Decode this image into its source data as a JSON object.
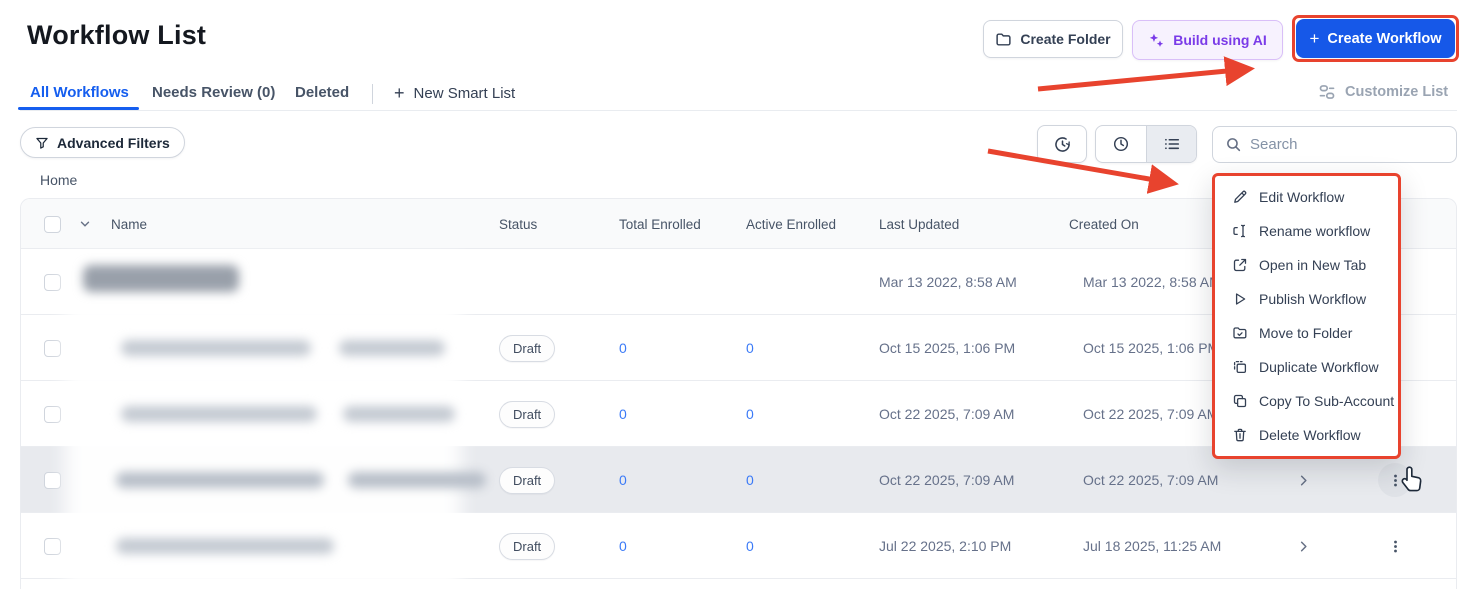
{
  "title": "Workflow List",
  "actions": {
    "plus": "+",
    "create_folder": "Create Folder",
    "build_using_ai": "Build using AI",
    "create_workflow": "Create Workflow"
  },
  "tabs": {
    "all_workflows": "All Workflows",
    "needs_review": "Needs Review (0)",
    "deleted": "Deleted",
    "new_smart_list": "New Smart List"
  },
  "customize_list": "Customize List",
  "advanced_filters": "Advanced Filters",
  "search": {
    "placeholder": "Search"
  },
  "breadcrumb": "Home",
  "table": {
    "headers": {
      "name": "Name",
      "status": "Status",
      "total_enrolled": "Total Enrolled",
      "active_enrolled": "Active Enrolled",
      "last_updated": "Last Updated",
      "created_on": "Created On"
    },
    "rows": [
      {
        "status": "",
        "total_enrolled": "",
        "active_enrolled": "",
        "last_updated": "Mar 13 2022, 8:58 AM",
        "created_on": "Mar 13 2022, 8:58 AM",
        "highlighted": false
      },
      {
        "status": "Draft",
        "total_enrolled": "0",
        "active_enrolled": "0",
        "last_updated": "Oct 15 2025, 1:06 PM",
        "created_on": "Oct 15 2025, 1:06 PM",
        "highlighted": false
      },
      {
        "status": "Draft",
        "total_enrolled": "0",
        "active_enrolled": "0",
        "last_updated": "Oct 22 2025, 7:09 AM",
        "created_on": "Oct 22 2025, 7:09 AM",
        "highlighted": false
      },
      {
        "status": "Draft",
        "total_enrolled": "0",
        "active_enrolled": "0",
        "last_updated": "Oct 22 2025, 7:09 AM",
        "created_on": "Oct 22 2025, 7:09 AM",
        "highlighted": true
      },
      {
        "status": "Draft",
        "total_enrolled": "0",
        "active_enrolled": "0",
        "last_updated": "Jul 22 2025, 2:10 PM",
        "created_on": "Jul 18 2025, 11:25 AM",
        "highlighted": false
      }
    ]
  },
  "context_menu": {
    "items": [
      {
        "label": "Edit Workflow",
        "icon": "pencil-icon"
      },
      {
        "label": "Rename workflow",
        "icon": "rename-icon"
      },
      {
        "label": "Open in New Tab",
        "icon": "external-link-icon"
      },
      {
        "label": "Publish Workflow",
        "icon": "play-icon"
      },
      {
        "label": "Move to Folder",
        "icon": "folder-move-icon"
      },
      {
        "label": "Duplicate Workflow",
        "icon": "duplicate-icon"
      },
      {
        "label": "Copy To Sub-Account",
        "icon": "copy-icon"
      },
      {
        "label": "Delete Workflow",
        "icon": "trash-icon"
      }
    ]
  },
  "colors": {
    "primary_blue": "#1658E8",
    "link_blue": "#3B7AF7",
    "annotation_red": "#E8432E",
    "purple": "#7A3BE8",
    "purple_bg": "#F7F2FE",
    "text_dark": "#101828",
    "text_gray": "#475467",
    "disabled_gray": "#9AA4B2",
    "border": "#D0D5DD",
    "divider": "#EAECF0",
    "header_bg": "#F9FAFB",
    "row_highlight": "#E8EAEE"
  }
}
